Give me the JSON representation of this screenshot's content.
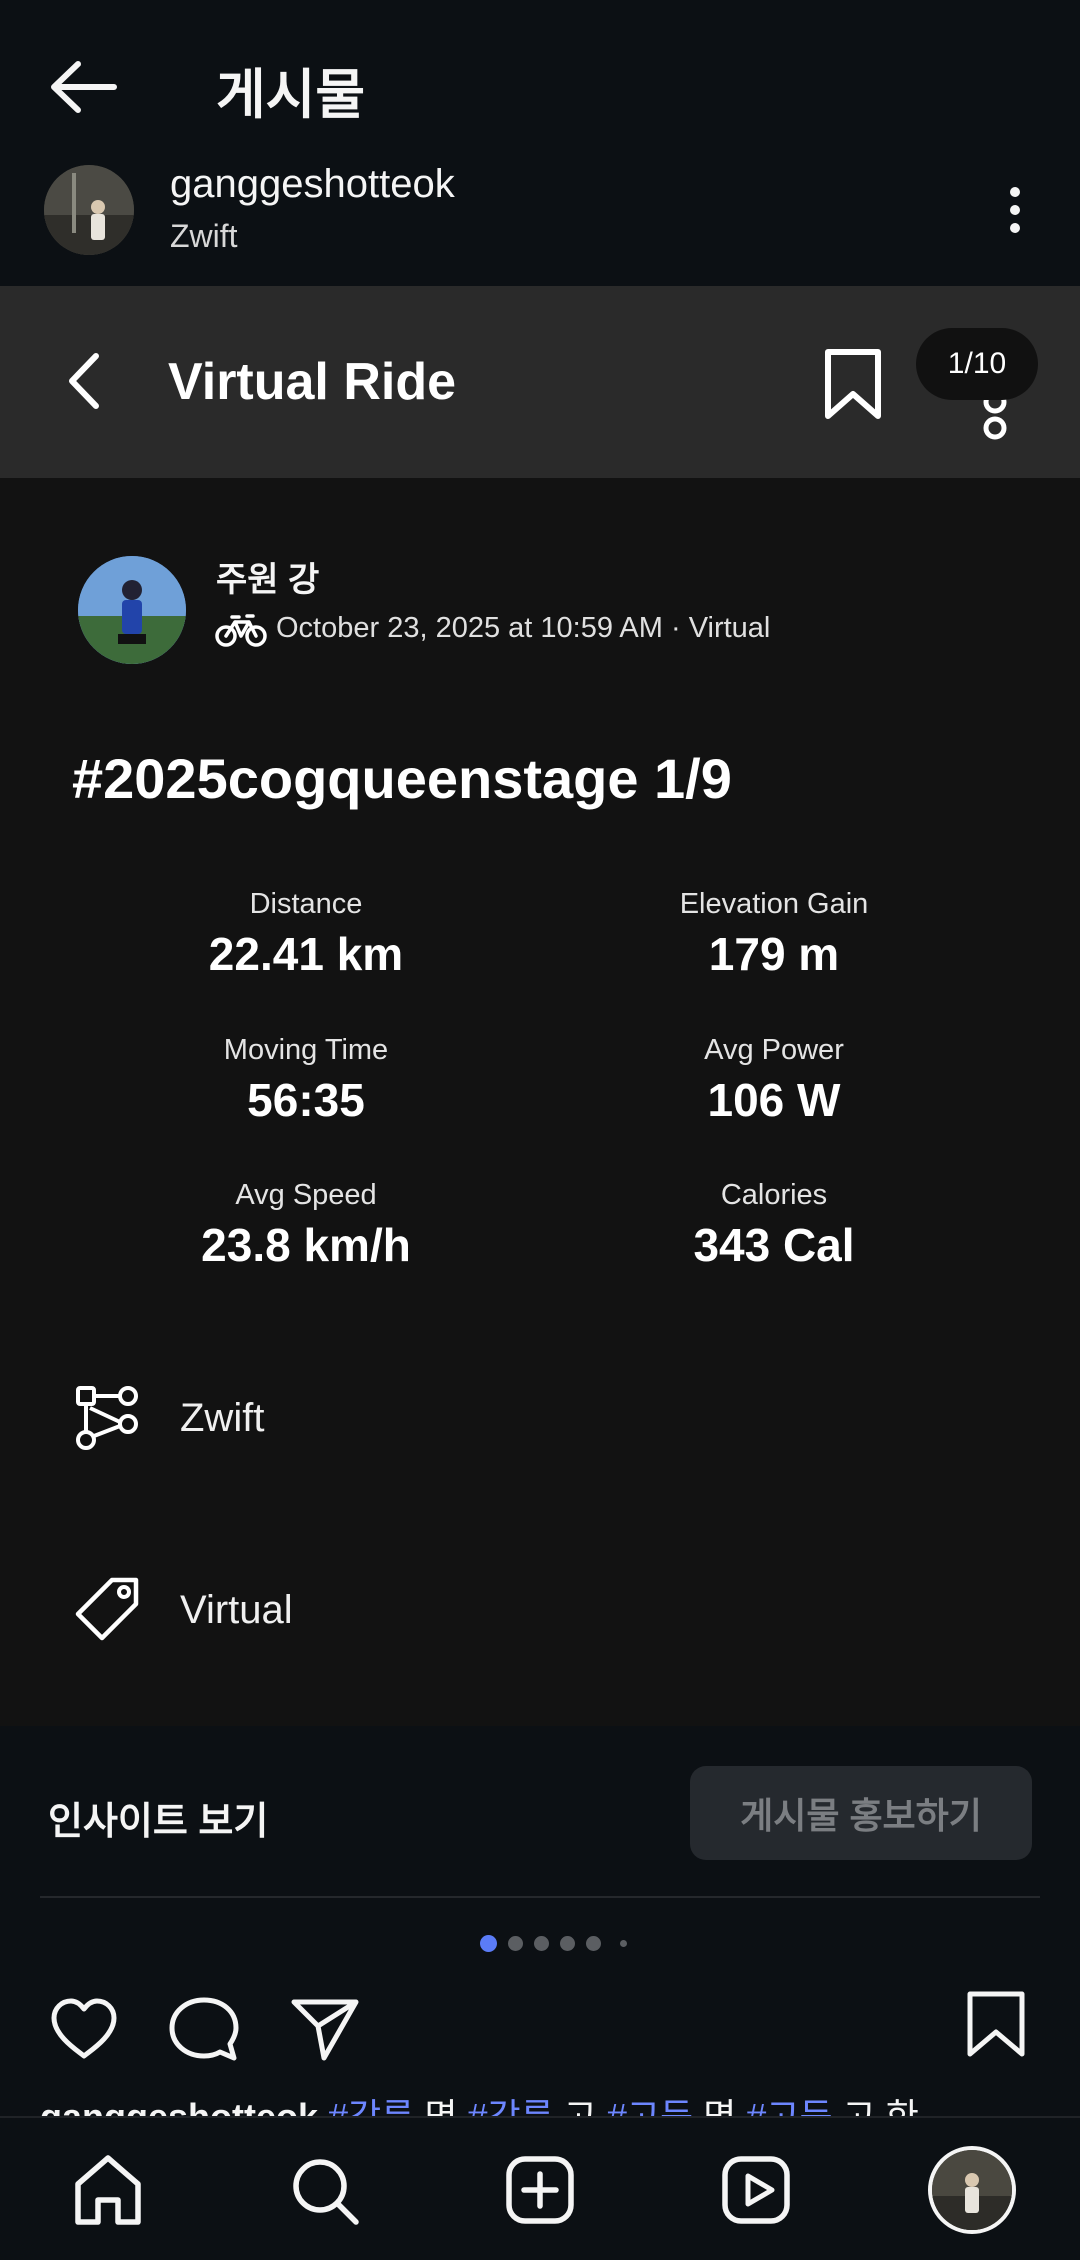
{
  "header": {
    "title": "게시물"
  },
  "profile": {
    "username": "ganggeshotteok",
    "subtitle": "Zwift"
  },
  "post": {
    "activity_type": "Virtual Ride",
    "counter": "1/10",
    "athlete": {
      "name": "주원 강",
      "meta": "October 23, 2025 at 10:59 AM · Virtual"
    },
    "title": "#2025cogqueenstage 1/9",
    "stats": [
      {
        "label": "Distance",
        "value": "22.41 km"
      },
      {
        "label": "Elevation Gain",
        "value": "179 m"
      },
      {
        "label": "Moving Time",
        "value": "56:35"
      },
      {
        "label": "Avg Power",
        "value": "106 W"
      },
      {
        "label": "Avg Speed",
        "value": "23.8 km/h"
      },
      {
        "label": "Calories",
        "value": "343 Cal"
      }
    ],
    "route": "Zwift",
    "tag": "Virtual"
  },
  "actions": {
    "insights": "인사이트 보기",
    "promote": "게시물 홍보하기"
  },
  "carousel": {
    "total": 6,
    "active": 1
  },
  "caption": {
    "username": "ganggeshotteok",
    "parts": [
      "#강릉",
      "명",
      "#강릉",
      "고",
      "#고등",
      "명",
      "#고등",
      "고 한"
    ]
  },
  "colors": {
    "accent": "#6d86ff",
    "active_dot": "#5b7cf7"
  },
  "icons": [
    "back-arrow-icon",
    "more-icon",
    "chevron-left-icon",
    "bookmark-icon",
    "bike-icon",
    "route-icon",
    "tag-icon",
    "heart-icon",
    "comment-icon",
    "send-icon",
    "home-icon",
    "search-icon",
    "create-icon",
    "reels-icon"
  ]
}
